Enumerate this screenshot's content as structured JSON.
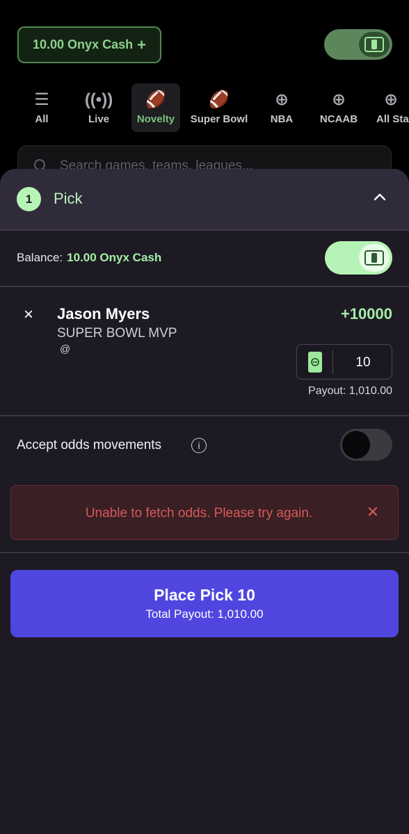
{
  "topbar": {
    "cash_label": "10.00 Onyx Cash",
    "plus_glyph": "+"
  },
  "categories": [
    {
      "label": "All",
      "icon": "list-icon"
    },
    {
      "label": "Live",
      "icon": "broadcast-icon"
    },
    {
      "label": "Novelty",
      "icon": "novelty-football-icon",
      "active": true
    },
    {
      "label": "Super Bowl",
      "icon": "football-icon"
    },
    {
      "label": "NBA",
      "icon": "basketball-icon"
    },
    {
      "label": "NCAAB",
      "icon": "basketball-icon"
    },
    {
      "label": "All Sta",
      "icon": "basketball-icon"
    }
  ],
  "search": {
    "placeholder": "Search games, teams, leagues..."
  },
  "betslip": {
    "count": "1",
    "title": "Pick",
    "balance_label": "Balance:",
    "balance_amount": "10.00 Onyx Cash",
    "selection": {
      "remove_glyph": "×",
      "player": "Jason Myers",
      "market": "SUPER BOWL MVP",
      "matchup": "@",
      "odds": "+10000",
      "stake": "10",
      "payout": "Payout: 1,010.00"
    },
    "accept_odds_label": "Accept odds movements",
    "accept_odds_enabled": false,
    "error_message": "Unable to fetch odds. Please try again.",
    "place_button": {
      "label": "Place Pick 10",
      "total_payout": "Total Payout: 1,010.00"
    }
  },
  "colors": {
    "accent_green": "#a6eea6",
    "error_red": "#d75a5a",
    "primary_button": "#4f46e0",
    "sheet_bg": "#1d1a24"
  }
}
